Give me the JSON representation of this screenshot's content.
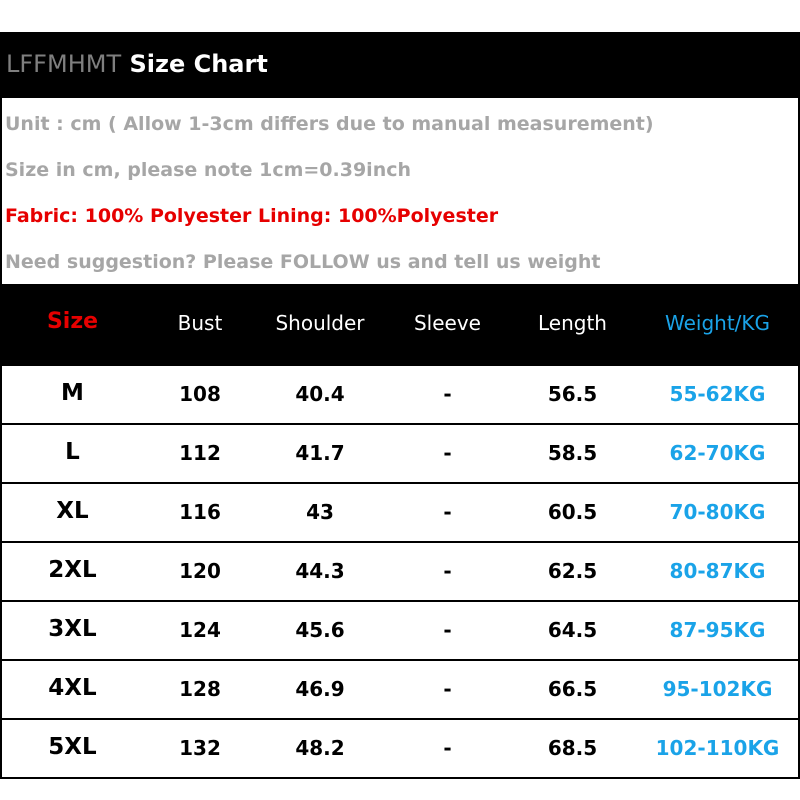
{
  "title": {
    "brand": "LFFMHMT",
    "text": "Size Chart"
  },
  "notes": [
    {
      "text": "Unit : cm ( Allow 1-3cm differs due to manual measurement)",
      "color": "#a6a6a6"
    },
    {
      "text": "Size in cm, please note 1cm=0.39inch",
      "color": "#a6a6a6"
    },
    {
      "text": "Fabric: 100% Polyester   Lining: 100%Polyester",
      "color": "#e60000"
    },
    {
      "text": "Need suggestion? Please FOLLOW us and tell us weight",
      "color": "#a6a6a6"
    }
  ],
  "table": {
    "headers": [
      "Size",
      "Bust",
      "Shoulder",
      "Sleeve",
      "Length",
      "Weight/KG"
    ],
    "rows": [
      [
        "M",
        "108",
        "40.4",
        "-",
        "56.5",
        "55-62KG"
      ],
      [
        "L",
        "112",
        "41.7",
        "-",
        "58.5",
        "62-70KG"
      ],
      [
        "XL",
        "116",
        "43",
        "-",
        "60.5",
        "70-80KG"
      ],
      [
        "2XL",
        "120",
        "44.3",
        "-",
        "62.5",
        "80-87KG"
      ],
      [
        "3XL",
        "124",
        "45.6",
        "-",
        "64.5",
        "87-95KG"
      ],
      [
        "4XL",
        "128",
        "46.9",
        "-",
        "66.5",
        "95-102KG"
      ],
      [
        "5XL",
        "132",
        "48.2",
        "-",
        "68.5",
        "102-110KG"
      ]
    ]
  },
  "colors": {
    "header_bg": "#000000",
    "size_header": "#e60000",
    "weight": "#1aa3e8",
    "note_gray": "#a6a6a6",
    "note_red": "#e60000"
  }
}
